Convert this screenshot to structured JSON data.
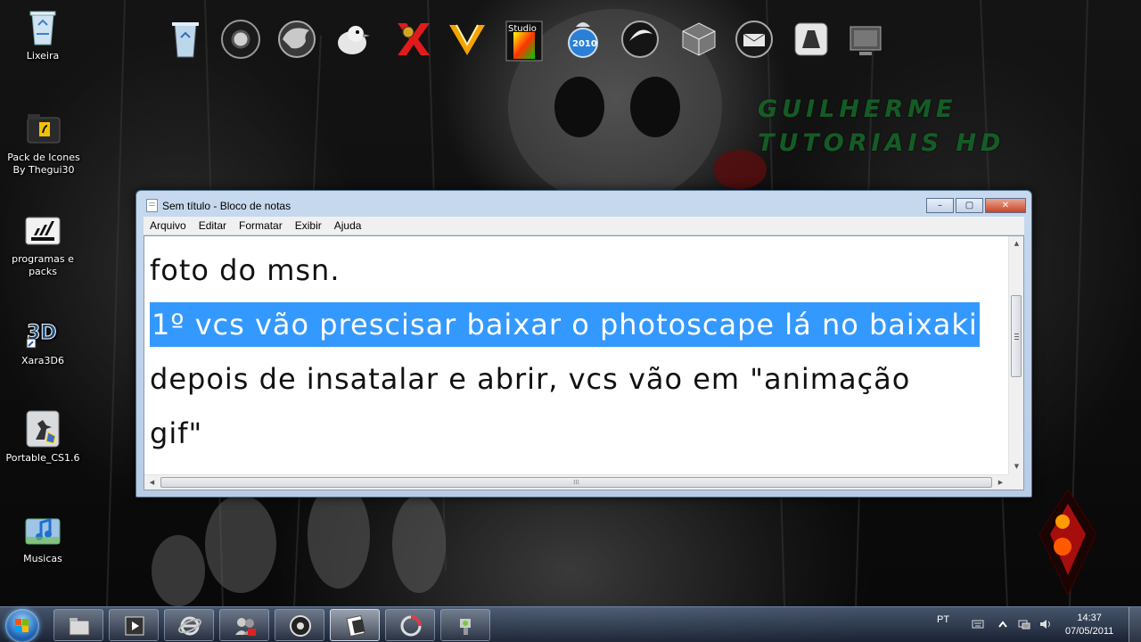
{
  "desktop": {
    "icons": [
      {
        "label": "Lixeira",
        "icon": "recycle-bin-icon"
      },
      {
        "label": "Pack de Icones By Thegui30",
        "icon": "ferrari-folder-icon"
      },
      {
        "label": "programas e packs",
        "icon": "adidas-folder-icon"
      },
      {
        "label": "Xara3D6",
        "icon": "xara3d-icon"
      },
      {
        "label": "Portable_CS1.6",
        "icon": "counter-strike-icon"
      },
      {
        "label": "Musicas",
        "icon": "music-folder-icon"
      }
    ],
    "dock_studio_label": "Studio",
    "dock_2010_label": "2010",
    "watermark_line1": "GUILHERME",
    "watermark_line2": "TUTORIAIS HD"
  },
  "notepad": {
    "title": "Sem título - Bloco de notas",
    "menu": [
      "Arquivo",
      "Editar",
      "Formatar",
      "Exibir",
      "Ajuda"
    ],
    "lines": [
      "foto do msn.",
      "1º vcs vão prescisar baixar o photoscape lá no baixaki",
      "depois de insatalar e abrir, vcs vão em \"animação",
      "gif\""
    ],
    "selected_line_index": 1,
    "window_buttons": {
      "minimize": "–",
      "maximize": "▢",
      "close": "✕"
    }
  },
  "taskbar": {
    "language": "PT",
    "time": "14:37",
    "date": "07/05/2011"
  }
}
